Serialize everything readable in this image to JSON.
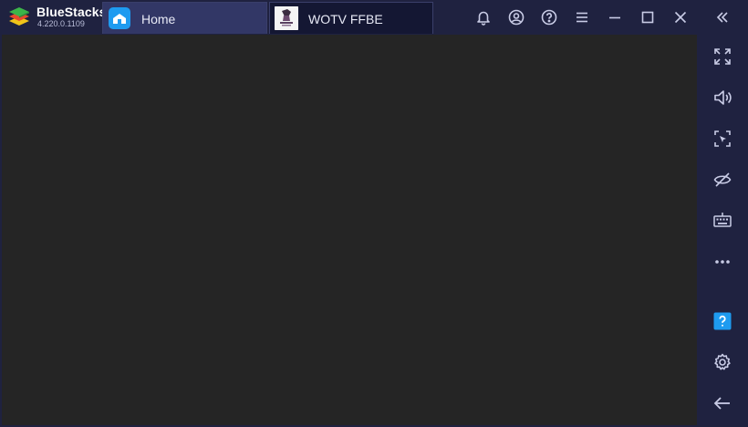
{
  "app": {
    "name": "BlueStacks",
    "version": "4.220.0.1109"
  },
  "tabs": [
    {
      "label": "Home",
      "icon": "home-icon",
      "active": false
    },
    {
      "label": "WOTV FFBE",
      "icon": "game-thumbnail",
      "active": true
    }
  ],
  "titlebar_actions": [
    "bell-icon",
    "account-icon",
    "help-icon",
    "menu-icon",
    "minimize-icon",
    "maximize-icon",
    "close-icon",
    "collapse-sidebar-icon"
  ],
  "sidebar_actions": [
    "fullscreen-icon",
    "volume-icon",
    "screenshot-icon",
    "eye-off-icon",
    "keyboard-icon",
    "more-icon",
    "help-badge-icon",
    "settings-icon",
    "back-icon"
  ],
  "colors": {
    "chrome": "#1f2240",
    "active_tab": "#141733",
    "home_tab": "#323766",
    "content": "#252525",
    "accent": "#1e9bf0"
  }
}
